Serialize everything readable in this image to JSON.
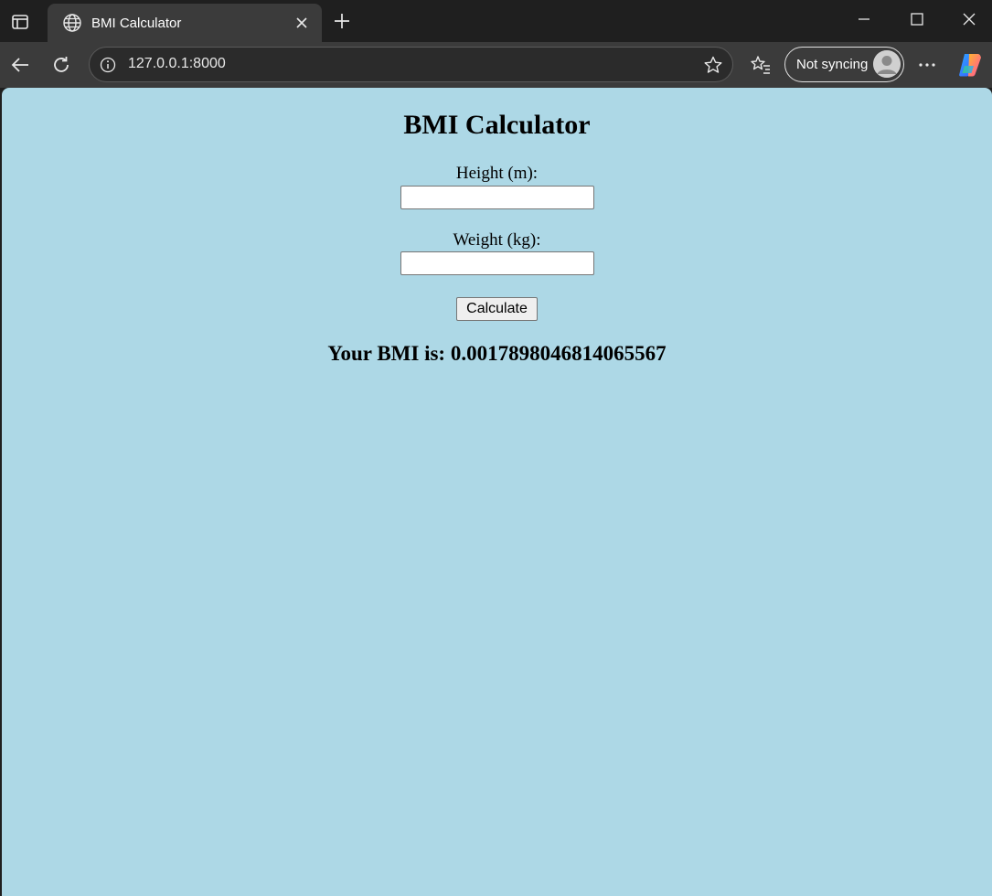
{
  "browser": {
    "tab": {
      "title": "BMI Calculator",
      "favicon": "globe-icon"
    },
    "address_bar": {
      "url": "127.0.0.1:8000"
    },
    "profile": {
      "label": "Not syncing"
    },
    "colors": {
      "chrome_dark": "#1f1f1f",
      "chrome_toolbar": "#3b3b3b"
    }
  },
  "page": {
    "background": "#add8e6",
    "title": "BMI Calculator",
    "height_label": "Height (m):",
    "height_value": "",
    "weight_label": "Weight (kg):",
    "weight_value": "",
    "calculate_label": "Calculate",
    "result_text": "Your BMI is: 0.0017898046814065567"
  }
}
